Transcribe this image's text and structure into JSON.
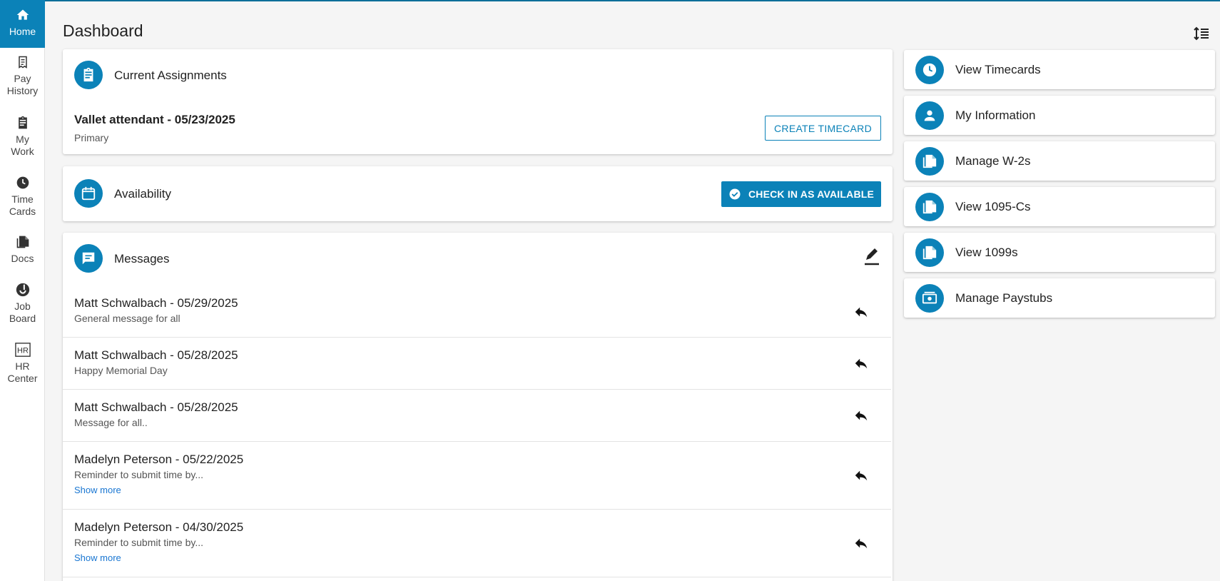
{
  "sidebar": {
    "items": [
      {
        "label1": "Home",
        "label2": "",
        "icon": "home-icon"
      },
      {
        "label1": "Pay",
        "label2": "History",
        "icon": "receipt-icon"
      },
      {
        "label1": "My",
        "label2": "Work",
        "icon": "clipboard-icon"
      },
      {
        "label1": "Time",
        "label2": "Cards",
        "icon": "clock-icon"
      },
      {
        "label1": "Docs",
        "label2": "",
        "icon": "documents-icon"
      },
      {
        "label1": "Job",
        "label2": "Board",
        "icon": "job-board-icon"
      },
      {
        "label1": "HR",
        "label2": "Center",
        "icon": "hr-icon"
      }
    ]
  },
  "header": {
    "title": "Dashboard"
  },
  "assignments": {
    "title": "Current Assignments",
    "job": "Vallet attendant - 05/23/2025",
    "type": "Primary",
    "button": "CREATE TIMECARD"
  },
  "availability": {
    "title": "Availability",
    "button": "CHECK IN AS AVAILABLE"
  },
  "messages": {
    "title": "Messages",
    "items": [
      {
        "header": "Matt Schwalbach - 05/29/2025",
        "body": "General message for all",
        "more": ""
      },
      {
        "header": "Matt Schwalbach - 05/28/2025",
        "body": "Happy Memorial Day",
        "more": ""
      },
      {
        "header": "Matt Schwalbach - 05/28/2025",
        "body": "Message for all..",
        "more": ""
      },
      {
        "header": "Madelyn Peterson - 05/22/2025",
        "body": "Reminder to submit time by...",
        "more": "Show more"
      },
      {
        "header": "Madelyn Peterson - 04/30/2025",
        "body": "Reminder to submit time by...",
        "more": "Show more"
      }
    ]
  },
  "quick_links": [
    {
      "label": "View Timecards",
      "icon": "clock-icon"
    },
    {
      "label": "My Information",
      "icon": "person-icon"
    },
    {
      "label": "Manage W-2s",
      "icon": "documents-icon"
    },
    {
      "label": "View 1095-Cs",
      "icon": "documents-icon"
    },
    {
      "label": "View 1099s",
      "icon": "documents-icon"
    },
    {
      "label": "Manage Paystubs",
      "icon": "paystub-icon"
    }
  ],
  "colors": {
    "accent": "#0b82b8",
    "link": "#1976d2",
    "background": "#f5f5f5"
  }
}
